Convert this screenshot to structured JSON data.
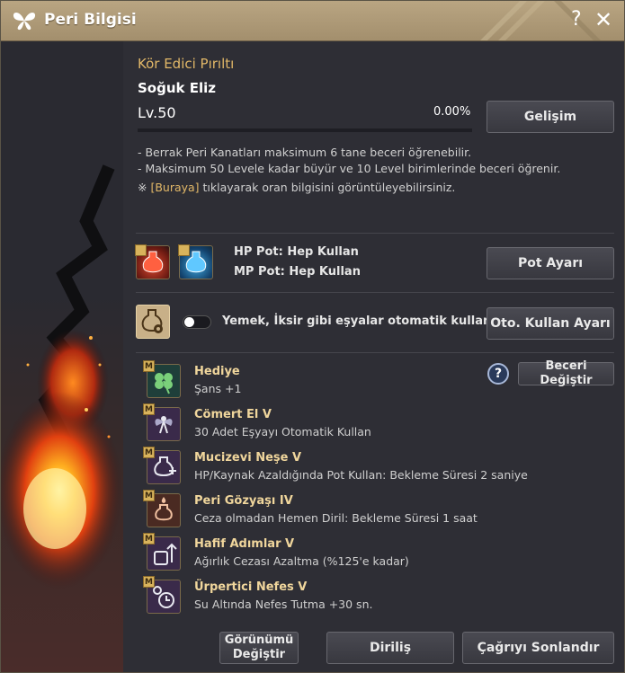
{
  "window": {
    "title": "Peri Bilgisi",
    "help_glyph": "?",
    "close_glyph": "✕"
  },
  "fairy": {
    "type": "Kör Edici Pırıltı",
    "name": "Soğuk Eliz",
    "level": "Lv.50",
    "exp_percent": "0.00%",
    "exp_fraction": 0,
    "upgrade_button": "Gelişim",
    "notes": [
      "- Berrak Peri Kanatları maksimum 6 tane beceri öğrenebilir.",
      "- Maksimum 50 Levele kadar büyür ve 10 Level birimlerinde beceri öğrenir."
    ],
    "info_prefix": "※ ",
    "info_link": "[Buraya]",
    "info_suffix": " tıklayarak oran bilgisini görüntüleyebilirsiniz."
  },
  "potions": {
    "hp_label": "HP Pot: Hep Kullan",
    "mp_label": "MP Pot: Hep Kullan",
    "button": "Pot Ayarı"
  },
  "auto_use": {
    "label": "Yemek, İksir gibi eşyalar otomatik kullanılır.",
    "toggle_on": false,
    "button": "Oto. Kullan Ayarı"
  },
  "skills_header": {
    "help_glyph": "?",
    "change_button": "Beceri Değiştir"
  },
  "skills": [
    {
      "name": "Hediye",
      "desc": "Şans +1",
      "badge": "M",
      "icon": "clover-icon",
      "bg": "#1f3f3a"
    },
    {
      "name": "Cömert El V",
      "desc": "30 Adet Eşyayı Otomatik Kullan",
      "badge": "M",
      "icon": "fairy-icon",
      "bg": "#3a2a4a"
    },
    {
      "name": "Mucizevi Neşe V",
      "desc": "HP/Kaynak Azaldığında Pot Kullan: Bekleme Süresi 2 saniye",
      "badge": "M",
      "icon": "potion-plus-icon",
      "bg": "#3a2a4a"
    },
    {
      "name": "Peri Gözyaşı IV",
      "desc": "Ceza olmadan Hemen Diril: Bekleme Süresi 1 saat",
      "badge": "M",
      "icon": "tear-vial-icon",
      "bg": "#4a2a22"
    },
    {
      "name": "Hafif Adımlar V",
      "desc": "Ağırlık Cezası Azaltma (%125'e kadar)",
      "badge": "M",
      "icon": "weight-arrow-icon",
      "bg": "#3a2a4a"
    },
    {
      "name": "Ürpertici Nefes V",
      "desc": "Su Altında Nefes Tutma +30 sn.",
      "badge": "M",
      "icon": "breath-clock-icon",
      "bg": "#3a2a4a"
    }
  ],
  "footer": {
    "appearance_button_line1": "Görünümü",
    "appearance_button_line2": "Değiştir",
    "revive_button": "Diriliş",
    "dismiss_button": "Çağrıyı Sonlandır"
  },
  "colors": {
    "accent_gold": "#e2b868",
    "title_bar": "#b09b77",
    "panel": "#2e2e35"
  }
}
